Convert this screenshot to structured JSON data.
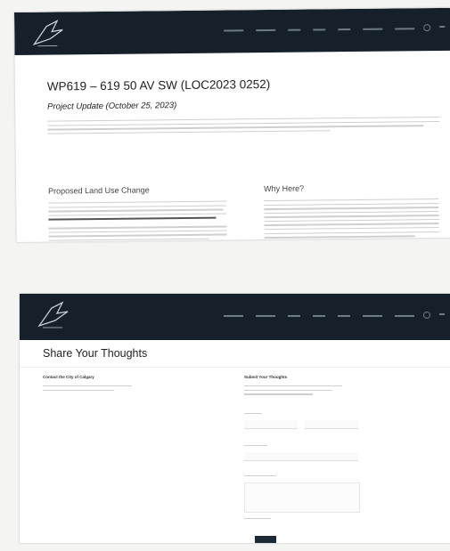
{
  "project": {
    "title": "WP619 – 619 50 AV SW (LOC2023 0252)",
    "update": "Project Update (October 25, 2023)",
    "section_left": "Proposed Land Use Change",
    "section_right": "Why Here?"
  },
  "feedback": {
    "title": "Share Your Thoughts",
    "contact_heading": "Contact the City of Calgary",
    "submit_heading": "Submit Your Thoughts"
  },
  "colors": {
    "nav_bg": "#15202b",
    "button_bg": "#1c2a36"
  },
  "icons": {
    "logo": "bird-wing-logo-icon",
    "search": "search-icon",
    "menu": "menu-icon"
  }
}
